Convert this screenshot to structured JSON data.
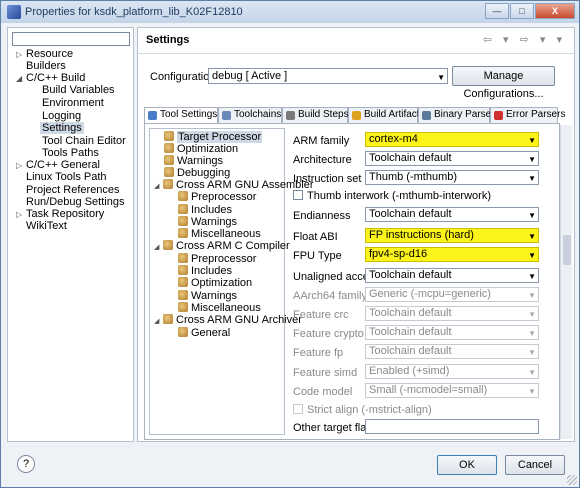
{
  "window": {
    "title": "Properties for ksdk_platform_lib_K02F12810",
    "controls": {
      "minimize": "—",
      "maximize": "□",
      "close": "X"
    }
  },
  "sidebar": {
    "filter_placeholder": "",
    "items": [
      {
        "label": "Resource",
        "twisty": "▷"
      },
      {
        "label": "Builders",
        "twisty": ""
      },
      {
        "label": "C/C++ Build",
        "twisty": "◢"
      },
      {
        "label": "Build Variables",
        "twisty": ""
      },
      {
        "label": "Environment",
        "twisty": ""
      },
      {
        "label": "Logging",
        "twisty": ""
      },
      {
        "label": "Settings",
        "twisty": ""
      },
      {
        "label": "Tool Chain Editor",
        "twisty": ""
      },
      {
        "label": "Tools Paths",
        "twisty": ""
      },
      {
        "label": "C/C++ General",
        "twisty": "▷"
      },
      {
        "label": "Linux Tools Path",
        "twisty": ""
      },
      {
        "label": "Project References",
        "twisty": ""
      },
      {
        "label": "Run/Debug Settings",
        "twisty": ""
      },
      {
        "label": "Task Repository",
        "twisty": "▷"
      },
      {
        "label": "WikiText",
        "twisty": ""
      }
    ]
  },
  "settings": {
    "title": "Settings",
    "nav": "⇦ ▾ ⇨ ▾ ▾",
    "configuration_label": "Configuration:",
    "configuration_value": "debug  [ Active ]",
    "manage_button": "Manage Configurations...",
    "tabs": [
      {
        "label": "Tool Settings",
        "icon_color": "#4a7bc8"
      },
      {
        "label": "Toolchains",
        "icon_color": "#6a8ab8"
      },
      {
        "label": "Build Steps",
        "icon_color": "#7a7a7a"
      },
      {
        "label": "Build Artifact",
        "icon_color": "#e0a020"
      },
      {
        "label": "Binary Parsers",
        "icon_color": "#5a7a9a"
      },
      {
        "label": "Error Parsers",
        "icon_color": "#d03030"
      }
    ],
    "tool_tree": [
      {
        "label": "Target Processor",
        "twisty": ""
      },
      {
        "label": "Optimization",
        "twisty": ""
      },
      {
        "label": "Warnings",
        "twisty": ""
      },
      {
        "label": "Debugging",
        "twisty": ""
      },
      {
        "label": "Cross ARM GNU Assembler",
        "twisty": "◢"
      },
      {
        "label": "Preprocessor",
        "twisty": ""
      },
      {
        "label": "Includes",
        "twisty": ""
      },
      {
        "label": "Warnings",
        "twisty": ""
      },
      {
        "label": "Miscellaneous",
        "twisty": ""
      },
      {
        "label": "Cross ARM C Compiler",
        "twisty": "◢"
      },
      {
        "label": "Preprocessor",
        "twisty": ""
      },
      {
        "label": "Includes",
        "twisty": ""
      },
      {
        "label": "Optimization",
        "twisty": ""
      },
      {
        "label": "Warnings",
        "twisty": ""
      },
      {
        "label": "Miscellaneous",
        "twisty": ""
      },
      {
        "label": "Cross ARM GNU Archiver",
        "twisty": "◢"
      },
      {
        "label": "General",
        "twisty": ""
      }
    ],
    "properties": {
      "arm_family": {
        "label": "ARM family",
        "value": "cortex-m4"
      },
      "architecture": {
        "label": "Architecture",
        "value": "Toolchain default"
      },
      "instruction_set": {
        "label": "Instruction set",
        "value": "Thumb (-mthumb)"
      },
      "thumb_interwork": {
        "label": "Thumb interwork (-mthumb-interwork)"
      },
      "endianness": {
        "label": "Endianness",
        "value": "Toolchain default"
      },
      "float_abi": {
        "label": "Float ABI",
        "value": "FP instructions (hard)"
      },
      "fpu_type": {
        "label": "FPU Type",
        "value": "fpv4-sp-d16"
      },
      "unaligned_access": {
        "label": "Unaligned access",
        "value": "Toolchain default"
      },
      "aarch64_family": {
        "label": "AArch64 family",
        "value": "Generic (-mcpu=generic)"
      },
      "feature_crc": {
        "label": "Feature crc",
        "value": "Toolchain default"
      },
      "feature_crypto": {
        "label": "Feature crypto",
        "value": "Toolchain default"
      },
      "feature_fp": {
        "label": "Feature fp",
        "value": "Toolchain default"
      },
      "feature_simd": {
        "label": "Feature simd",
        "value": "Enabled (+simd)"
      },
      "code_model": {
        "label": "Code model",
        "value": "Small (-mcmodel=small)"
      },
      "strict_align": {
        "label": "Strict align (-mstrict-align)"
      },
      "other_target_flags": {
        "label": "Other target flags",
        "value": ""
      }
    },
    "highlight_color": "#fbf31a"
  },
  "footer": {
    "help": "?",
    "ok": "OK",
    "cancel": "Cancel"
  }
}
